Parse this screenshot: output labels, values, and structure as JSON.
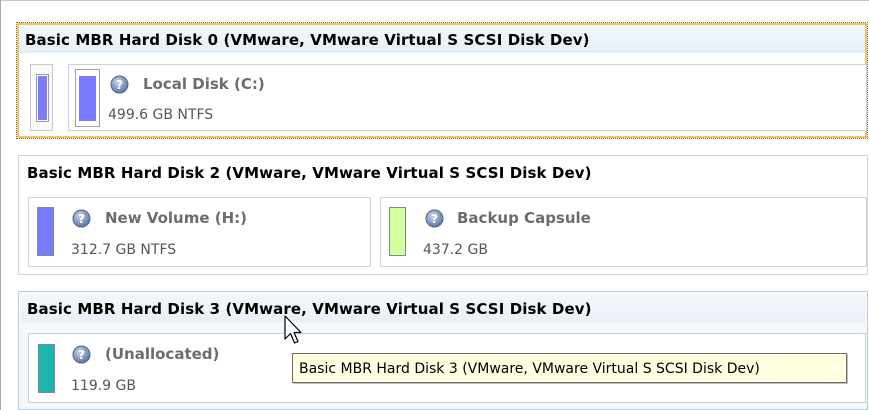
{
  "disks": [
    {
      "header": "Basic MBR Hard Disk 0 (VMware, VMware Virtual S SCSI Disk Dev)",
      "partitions": [
        {
          "name": "Local Disk (C:)",
          "info": "499.6 GB NTFS",
          "color": "#7b7bff"
        }
      ]
    },
    {
      "header": "Basic MBR Hard Disk 2 (VMware, VMware Virtual S SCSI Disk Dev)",
      "partitions": [
        {
          "name": "New Volume (H:)",
          "info": "312.7 GB NTFS",
          "color": "#7b7bff"
        },
        {
          "name": "Backup Capsule",
          "info": "437.2 GB",
          "color": "#d4ff9e"
        }
      ]
    },
    {
      "header": "Basic MBR Hard Disk 3 (VMware, VMware Virtual S SCSI Disk Dev)",
      "partitions": [
        {
          "name": "(Unallocated)",
          "info": "119.9 GB",
          "color": "#1bb5ad"
        }
      ]
    }
  ],
  "tooltip": "Basic MBR Hard Disk 3 (VMware, VMware Virtual S SCSI Disk Dev)",
  "icons": {
    "partition": "question-disk-icon",
    "cursor": "arrow-cursor-icon"
  }
}
